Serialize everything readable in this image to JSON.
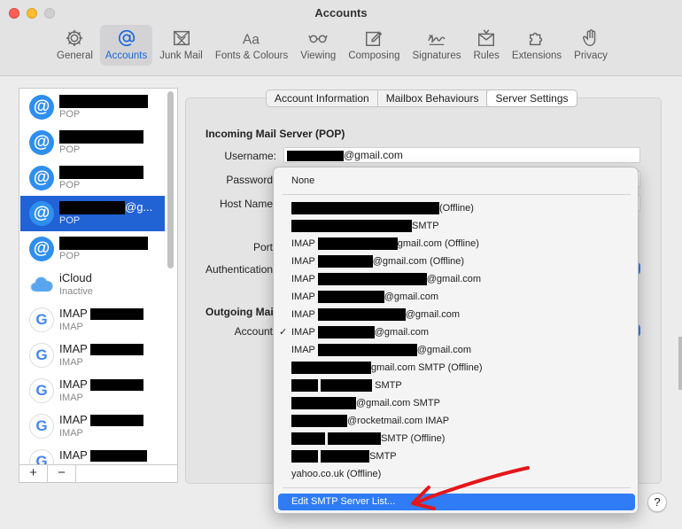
{
  "window": {
    "title": "Accounts"
  },
  "toolbar": {
    "tabs": [
      {
        "label": "General",
        "icon": "gear-icon"
      },
      {
        "label": "Accounts",
        "icon": "at-icon",
        "active": true
      },
      {
        "label": "Junk Mail",
        "icon": "junk-mail-icon"
      },
      {
        "label": "Fonts & Colours",
        "icon": "fonts-icon"
      },
      {
        "label": "Viewing",
        "icon": "glasses-icon"
      },
      {
        "label": "Composing",
        "icon": "compose-icon"
      },
      {
        "label": "Signatures",
        "icon": "signature-icon"
      },
      {
        "label": "Rules",
        "icon": "rules-icon"
      },
      {
        "label": "Extensions",
        "icon": "puzzle-icon"
      },
      {
        "label": "Privacy",
        "icon": "hand-icon"
      }
    ]
  },
  "sidebar": {
    "accounts": [
      {
        "name_suffix": "",
        "type": "POP",
        "icon": "mail-at-icon"
      },
      {
        "name_suffix": "",
        "type": "POP",
        "icon": "mail-at-icon"
      },
      {
        "name_suffix": "",
        "type": "POP",
        "icon": "mail-at-icon"
      },
      {
        "name_suffix": "@g...",
        "type": "POP",
        "icon": "mail-at-icon",
        "selected": true
      },
      {
        "name_suffix": "",
        "type": "POP",
        "icon": "mail-at-icon"
      },
      {
        "name_suffix": "iCloud",
        "type": "Inactive",
        "icon": "icloud-icon"
      },
      {
        "name_suffix": "IMAP",
        "type": "IMAP",
        "icon": "google-icon"
      },
      {
        "name_suffix": "IMAP",
        "type": "IMAP",
        "icon": "google-icon"
      },
      {
        "name_suffix": "IMAP",
        "type": "IMAP",
        "icon": "google-icon"
      },
      {
        "name_suffix": "IMAP",
        "type": "IMAP",
        "icon": "google-icon"
      },
      {
        "name_suffix": "IMAP",
        "type": "",
        "icon": "google-icon"
      }
    ],
    "add_label": "+",
    "remove_label": "−"
  },
  "segments": [
    "Account Information",
    "Mailbox Behaviours",
    "Server Settings"
  ],
  "incoming": {
    "heading": "Incoming Mail Server (POP)",
    "username_label": "Username:",
    "username_value": "@gmail.com",
    "password_label": "Password",
    "host_label": "Host Name",
    "port_label": "Port",
    "auth_label": "Authentication"
  },
  "outgoing": {
    "heading": "Outgoing Mai",
    "account_label": "Account"
  },
  "menu": {
    "none": "None",
    "items": [
      "(Offline)",
      "SMTP",
      "IMAP",
      "gmail.com (Offline)",
      "IMAP",
      "@gmail.com (Offline)",
      "IMAP",
      "@gmail.com",
      "IMAP",
      "@gmail.com",
      "IMAP",
      "@gmail.com",
      "IMAP",
      "@gmail.com",
      "IMAP",
      "@gmail.com",
      "gmail.com SMTP (Offline)",
      "SMTP",
      "@gmail.com SMTP",
      "@rocketmail.com IMAP",
      "SMTP (Offline)",
      "SMTP",
      "yahoo.co.uk (Offline)"
    ],
    "checked_mark": "✓",
    "edit_smtp": "Edit SMTP Server List..."
  },
  "help_label": "?",
  "colors": {
    "accent": "#2f7cf6",
    "selection": "#2162d4",
    "annotation": "#e4161b"
  }
}
